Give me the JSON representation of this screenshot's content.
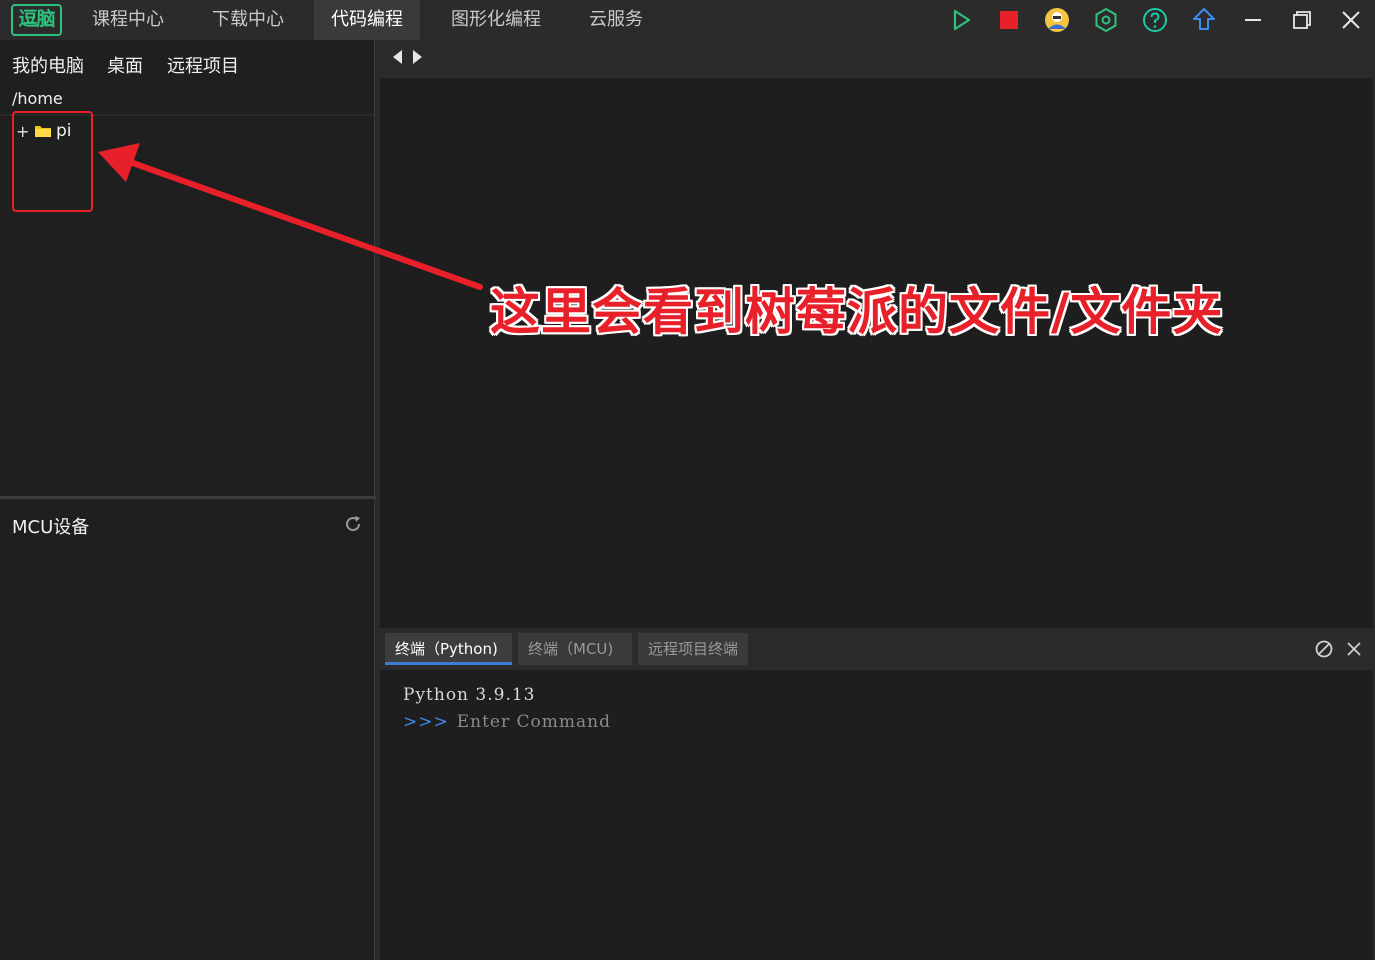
{
  "app": {
    "logo_text": "逗脑",
    "nav_tabs": [
      "课程中心",
      "下载中心",
      "代码编程",
      "图形化编程",
      "云服务"
    ],
    "active_tab": "代码编程"
  },
  "toolbar": {
    "icons": [
      "run-icon",
      "stop-icon",
      "user-avatar-icon",
      "hex-settings-icon",
      "help-icon",
      "upload-icon",
      "minimize-icon",
      "restore-icon",
      "close-icon"
    ],
    "colors": {
      "run": "#2ec27e",
      "stop": "#e8202a",
      "accent": "#1fc9a4"
    }
  },
  "file_panel": {
    "locations": [
      "我的电脑",
      "桌面",
      "远程项目"
    ],
    "current_path": "/home",
    "tree": [
      {
        "expander": "+",
        "name": "pi"
      }
    ],
    "mcu_title": "MCU设备"
  },
  "annotation": {
    "text": "这里会看到树莓派的文件/文件夹",
    "color": "#e8202a"
  },
  "terminal": {
    "tabs": [
      "终端（Python)",
      "终端（MCU)",
      "远程项目终端"
    ],
    "active_tab": "终端（Python)",
    "version_line": "Python 3.9.13",
    "prompt": ">>>",
    "input_placeholder": "Enter Command"
  }
}
